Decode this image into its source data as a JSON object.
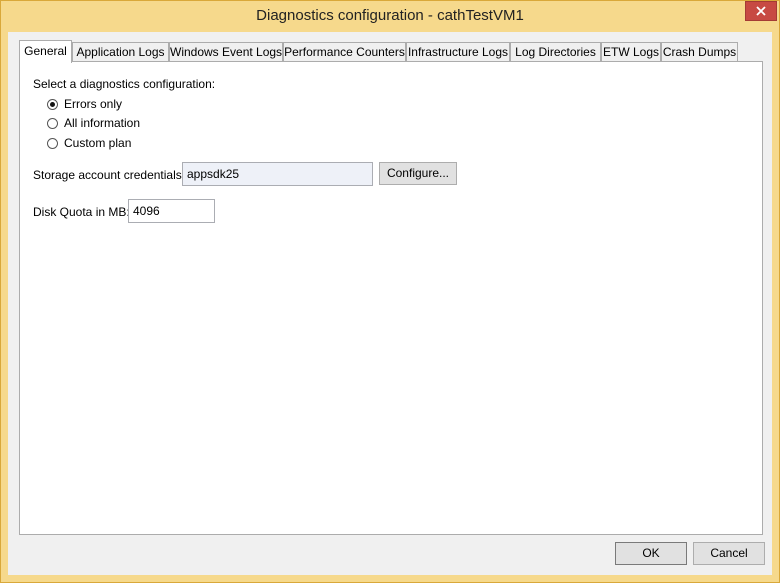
{
  "window": {
    "title": "Diagnostics configuration - cathTestVM1"
  },
  "tabs": [
    {
      "label": "General",
      "active": true
    },
    {
      "label": "Application Logs"
    },
    {
      "label": "Windows Event Logs"
    },
    {
      "label": "Performance Counters"
    },
    {
      "label": "Infrastructure Logs"
    },
    {
      "label": "Log Directories"
    },
    {
      "label": "ETW Logs"
    },
    {
      "label": "Crash Dumps"
    }
  ],
  "general": {
    "select_label": "Select a diagnostics configuration:",
    "options": [
      {
        "label": "Errors only",
        "checked": true
      },
      {
        "label": "All information",
        "checked": false
      },
      {
        "label": "Custom plan",
        "checked": false
      }
    ],
    "storage_label": "Storage account credentials:",
    "storage_value": "appsdk25",
    "configure_label": "Configure...",
    "quota_label": "Disk Quota in MB:",
    "quota_value": "4096"
  },
  "footer": {
    "ok_label": "OK",
    "cancel_label": "Cancel"
  }
}
